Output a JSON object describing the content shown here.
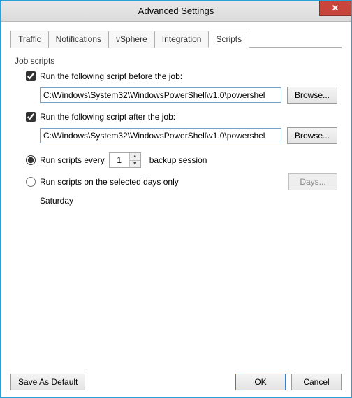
{
  "window": {
    "title": "Advanced Settings",
    "close_char": "✕"
  },
  "tabs": [
    {
      "label": "Traffic"
    },
    {
      "label": "Notifications"
    },
    {
      "label": "vSphere"
    },
    {
      "label": "Integration"
    },
    {
      "label": "Scripts",
      "active": true
    }
  ],
  "group_label": "Job scripts",
  "before": {
    "checkbox_label": "Run the following script before the job:",
    "checked": true,
    "path": "C:\\Windows\\System32\\WindowsPowerShell\\v1.0\\powershel",
    "browse_label": "Browse..."
  },
  "after": {
    "checkbox_label": "Run the following script after the job:",
    "checked": true,
    "path": "C:\\Windows\\System32\\WindowsPowerShell\\v1.0\\powershel",
    "browse_label": "Browse..."
  },
  "every": {
    "radio_label_prefix": "Run scripts every",
    "radio_label_suffix": "backup session",
    "value": "1",
    "selected": true
  },
  "days": {
    "radio_label": "Run scripts on the selected days only",
    "button_label": "Days...",
    "selected": false,
    "summary": "Saturday"
  },
  "footer": {
    "save_default": "Save As Default",
    "ok": "OK",
    "cancel": "Cancel"
  }
}
